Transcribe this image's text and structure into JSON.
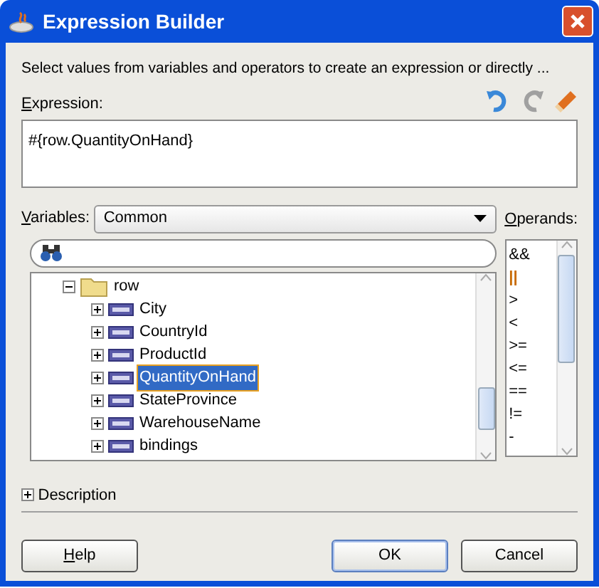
{
  "window": {
    "title": "Expression Builder"
  },
  "instruction": "Select values from variables and operators to create an expression or directly ...",
  "expression": {
    "label": "Expression:",
    "mnemonic": true,
    "value": "#{row.QuantityOnHand}"
  },
  "variables": {
    "label": "Variables:",
    "mnemonic": true,
    "value": "Common"
  },
  "operands": {
    "label": "Operands:",
    "mnemonic": true,
    "items": [
      {
        "label": "&&",
        "selected": false
      },
      {
        "label": "||",
        "selected": true
      },
      {
        "label": ">",
        "selected": false
      },
      {
        "label": "<",
        "selected": false
      },
      {
        "label": ">=",
        "selected": false
      },
      {
        "label": "<=",
        "selected": false
      },
      {
        "label": "==",
        "selected": false
      },
      {
        "label": "!=",
        "selected": false
      },
      {
        "label": "-",
        "selected": false
      }
    ]
  },
  "tree": [
    {
      "label": "row",
      "kind": "folder",
      "expanded": true,
      "selected": false,
      "children": [
        {
          "label": "City",
          "kind": "attribute",
          "expanded": false,
          "selected": false
        },
        {
          "label": "CountryId",
          "kind": "attribute",
          "expanded": false,
          "selected": false
        },
        {
          "label": "ProductId",
          "kind": "attribute",
          "expanded": false,
          "selected": false
        },
        {
          "label": "QuantityOnHand",
          "kind": "attribute",
          "expanded": false,
          "selected": true
        },
        {
          "label": "StateProvince",
          "kind": "attribute",
          "expanded": false,
          "selected": false
        },
        {
          "label": "WarehouseName",
          "kind": "attribute",
          "expanded": false,
          "selected": false
        },
        {
          "label": "bindings",
          "kind": "attribute",
          "expanded": false,
          "selected": false
        }
      ]
    }
  ],
  "description": {
    "label": "Description",
    "expanded": false
  },
  "buttons": [
    {
      "label": "Help",
      "mnemonic": true,
      "focused": false
    },
    {
      "label": "OK",
      "mnemonic": false,
      "focused": true
    },
    {
      "label": "Cancel",
      "mnemonic": false,
      "focused": false
    }
  ]
}
